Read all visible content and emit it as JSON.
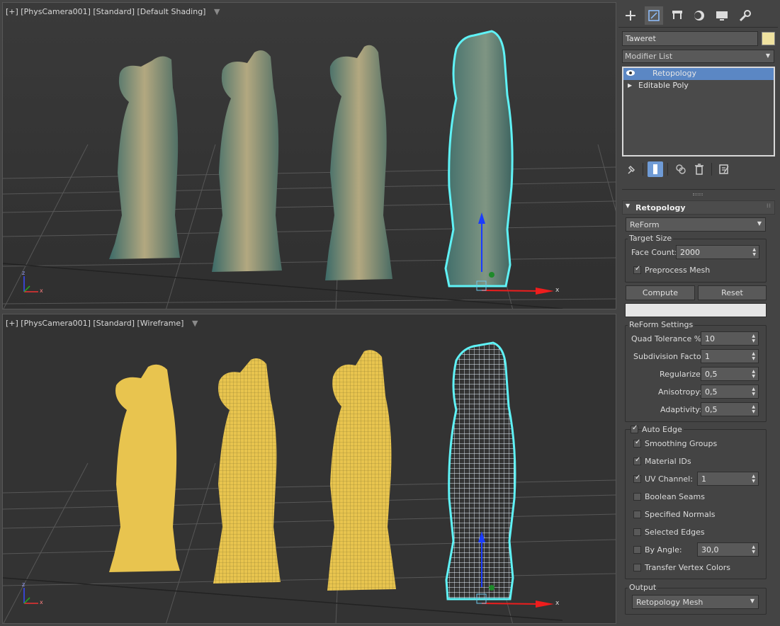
{
  "viewport_top": {
    "label": "[+] [PhysCamera001] [Standard] [Default Shading]",
    "axis_x": "x",
    "axis_z": "z"
  },
  "viewport_bottom": {
    "label": "[+] [PhysCamera001] [Standard] [Wireframe]",
    "axis_x": "x",
    "axis_z": "z"
  },
  "panel": {
    "tabs": [
      {
        "icon": "create-icon"
      },
      {
        "icon": "modify-icon"
      },
      {
        "icon": "hierarchy-icon"
      },
      {
        "icon": "motion-icon"
      },
      {
        "icon": "display-icon"
      },
      {
        "icon": "utilities-icon"
      }
    ],
    "object_name": "Taweret",
    "object_color": "#efe2a0",
    "modifier_list": "Modifier List",
    "stack": [
      {
        "label": "Retopology",
        "selected": true
      },
      {
        "label": "Editable Poly",
        "selected": false
      }
    ],
    "rollout_title": "Retopology",
    "method": "ReForm",
    "target_size": {
      "title": "Target Size",
      "face_count_label": "Face Count:",
      "face_count": "2000",
      "preprocess_label": "Preprocess Mesh",
      "preprocess_checked": true
    },
    "compute_label": "Compute",
    "reset_label": "Reset",
    "reform_settings": {
      "title": "ReForm Settings",
      "quad_tol_label": "Quad Tolerance %:",
      "quad_tol": "10",
      "subdiv_label": "Subdivision Factor:",
      "subdiv": "1",
      "regularize_label": "Regularize:",
      "regularize": "0,5",
      "anisotropy_label": "Anisotropy:",
      "anisotropy": "0,5",
      "adaptivity_label": "Adaptivity:",
      "adaptivity": "0,5"
    },
    "auto_edge": {
      "label": "Auto Edge",
      "checked": true,
      "smoothing_groups": "Smoothing Groups",
      "material_ids": "Material IDs",
      "uv_channel": "UV Channel:",
      "uv_channel_value": "1",
      "boolean_seams": "Boolean Seams",
      "specified_normals": "Specified Normals",
      "selected_edges": "Selected Edges",
      "by_angle": "By Angle:",
      "by_angle_value": "30,0",
      "transfer_vertex_colors": "Transfer Vertex Colors"
    },
    "output": {
      "title": "Output",
      "value": "Retopology Mesh"
    }
  }
}
